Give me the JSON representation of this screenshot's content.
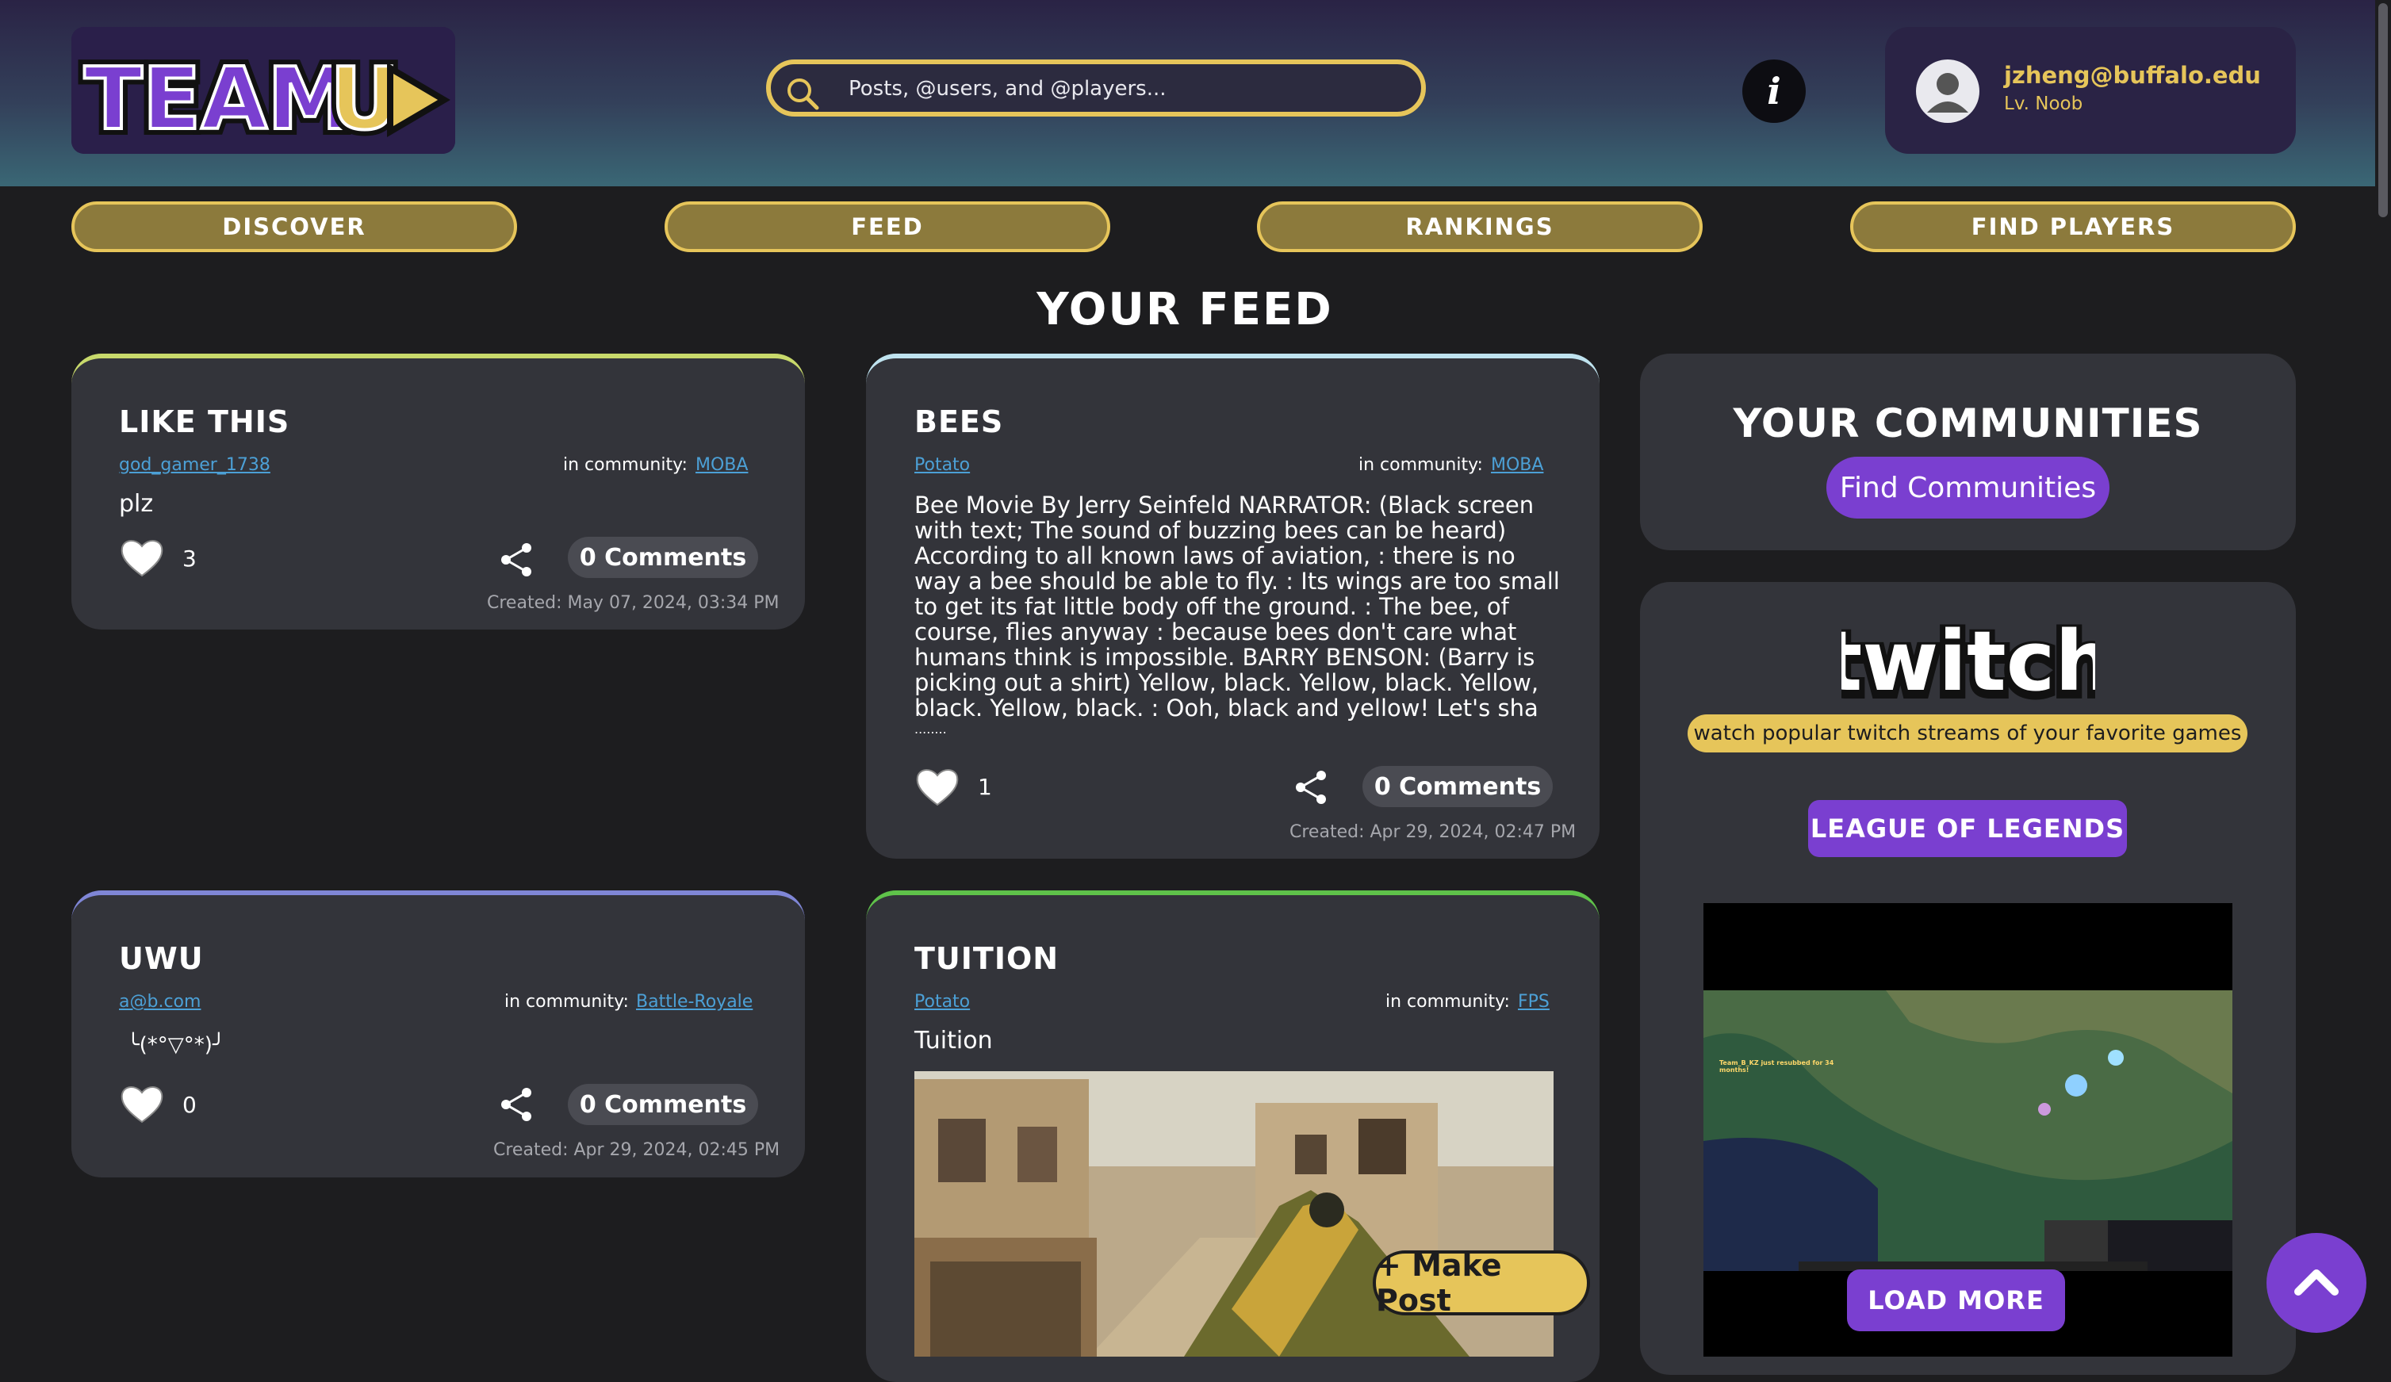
{
  "header": {
    "logo_text": "TeamUp",
    "search_placeholder": "Posts, @users, and @players...",
    "user": {
      "email": "jzheng@buffalo.edu",
      "level": "Lv. Noob"
    }
  },
  "nav": [
    "DISCOVER",
    "FEED",
    "RANKINGS",
    "FIND PLAYERS"
  ],
  "page_title": "YOUR FEED",
  "posts": [
    {
      "title": "LIKE THIS",
      "author": "god_gamer_1738",
      "community_prefix": "in community:",
      "community": "MOBA",
      "body": "plz",
      "likes": "3",
      "comments": "0 Comments",
      "created": "Created: May 07, 2024, 03:34 PM",
      "accent": "#c8d96b"
    },
    {
      "title": "BEES",
      "author": "Potato",
      "community_prefix": "in community:",
      "community": "MOBA",
      "body_lines": [
        "Bee Movie By Jerry Seinfeld NARRATOR: (Black screen",
        "with text; The sound of buzzing bees can be heard)",
        "According to all known laws of aviation, : there is no",
        "way a bee should be able to fly. : Its wings are too small",
        "to get its fat little body off the ground. : The bee, of",
        "course, flies anyway : because bees don't care what",
        "humans think is impossible. BARRY BENSON: (Barry is",
        "picking out a shirt) Yellow, black. Yellow, black. Yellow,",
        "black. Yellow, black. : Ooh, black and yellow! Let's sha",
        "........"
      ],
      "likes": "1",
      "comments": "0 Comments",
      "created": "Created: Apr 29, 2024, 02:47 PM",
      "accent": "#bfe3ef"
    },
    {
      "title": "UWU",
      "author": "a@b.com",
      "community_prefix": "in community:",
      "community": "Battle-Royale",
      "body": "╰(*°▽°*)╯",
      "likes": "0",
      "comments": "0 Comments",
      "created": "Created: Apr 29, 2024, 02:45 PM",
      "accent": "#7f86d6"
    },
    {
      "title": "TUITION",
      "author": "Potato",
      "community_prefix": "in community:",
      "community": "FPS",
      "body": "Tuition",
      "accent": "#5fc24a"
    }
  ],
  "make_post": "+ Make Post",
  "sidebar": {
    "communities_title": "YOUR COMMUNITIES",
    "find_communities": "Find Communities",
    "twitch_logo": "twitch",
    "twitch_tagline": "watch popular twitch streams of your favorite games",
    "game_button": "LEAGUE OF LEGENDS",
    "stream_notice": "Team_B_KZ just resubbed for 34 months!",
    "load_more": "LOAD MORE"
  },
  "colors": {
    "accent_gold": "#e6c55a",
    "accent_purple": "#7a3fd0",
    "link": "#4ca0d6"
  },
  "icons": [
    "search-icon",
    "info-icon",
    "user-avatar-icon",
    "heart-icon",
    "share-icon",
    "chevron-up-icon"
  ]
}
